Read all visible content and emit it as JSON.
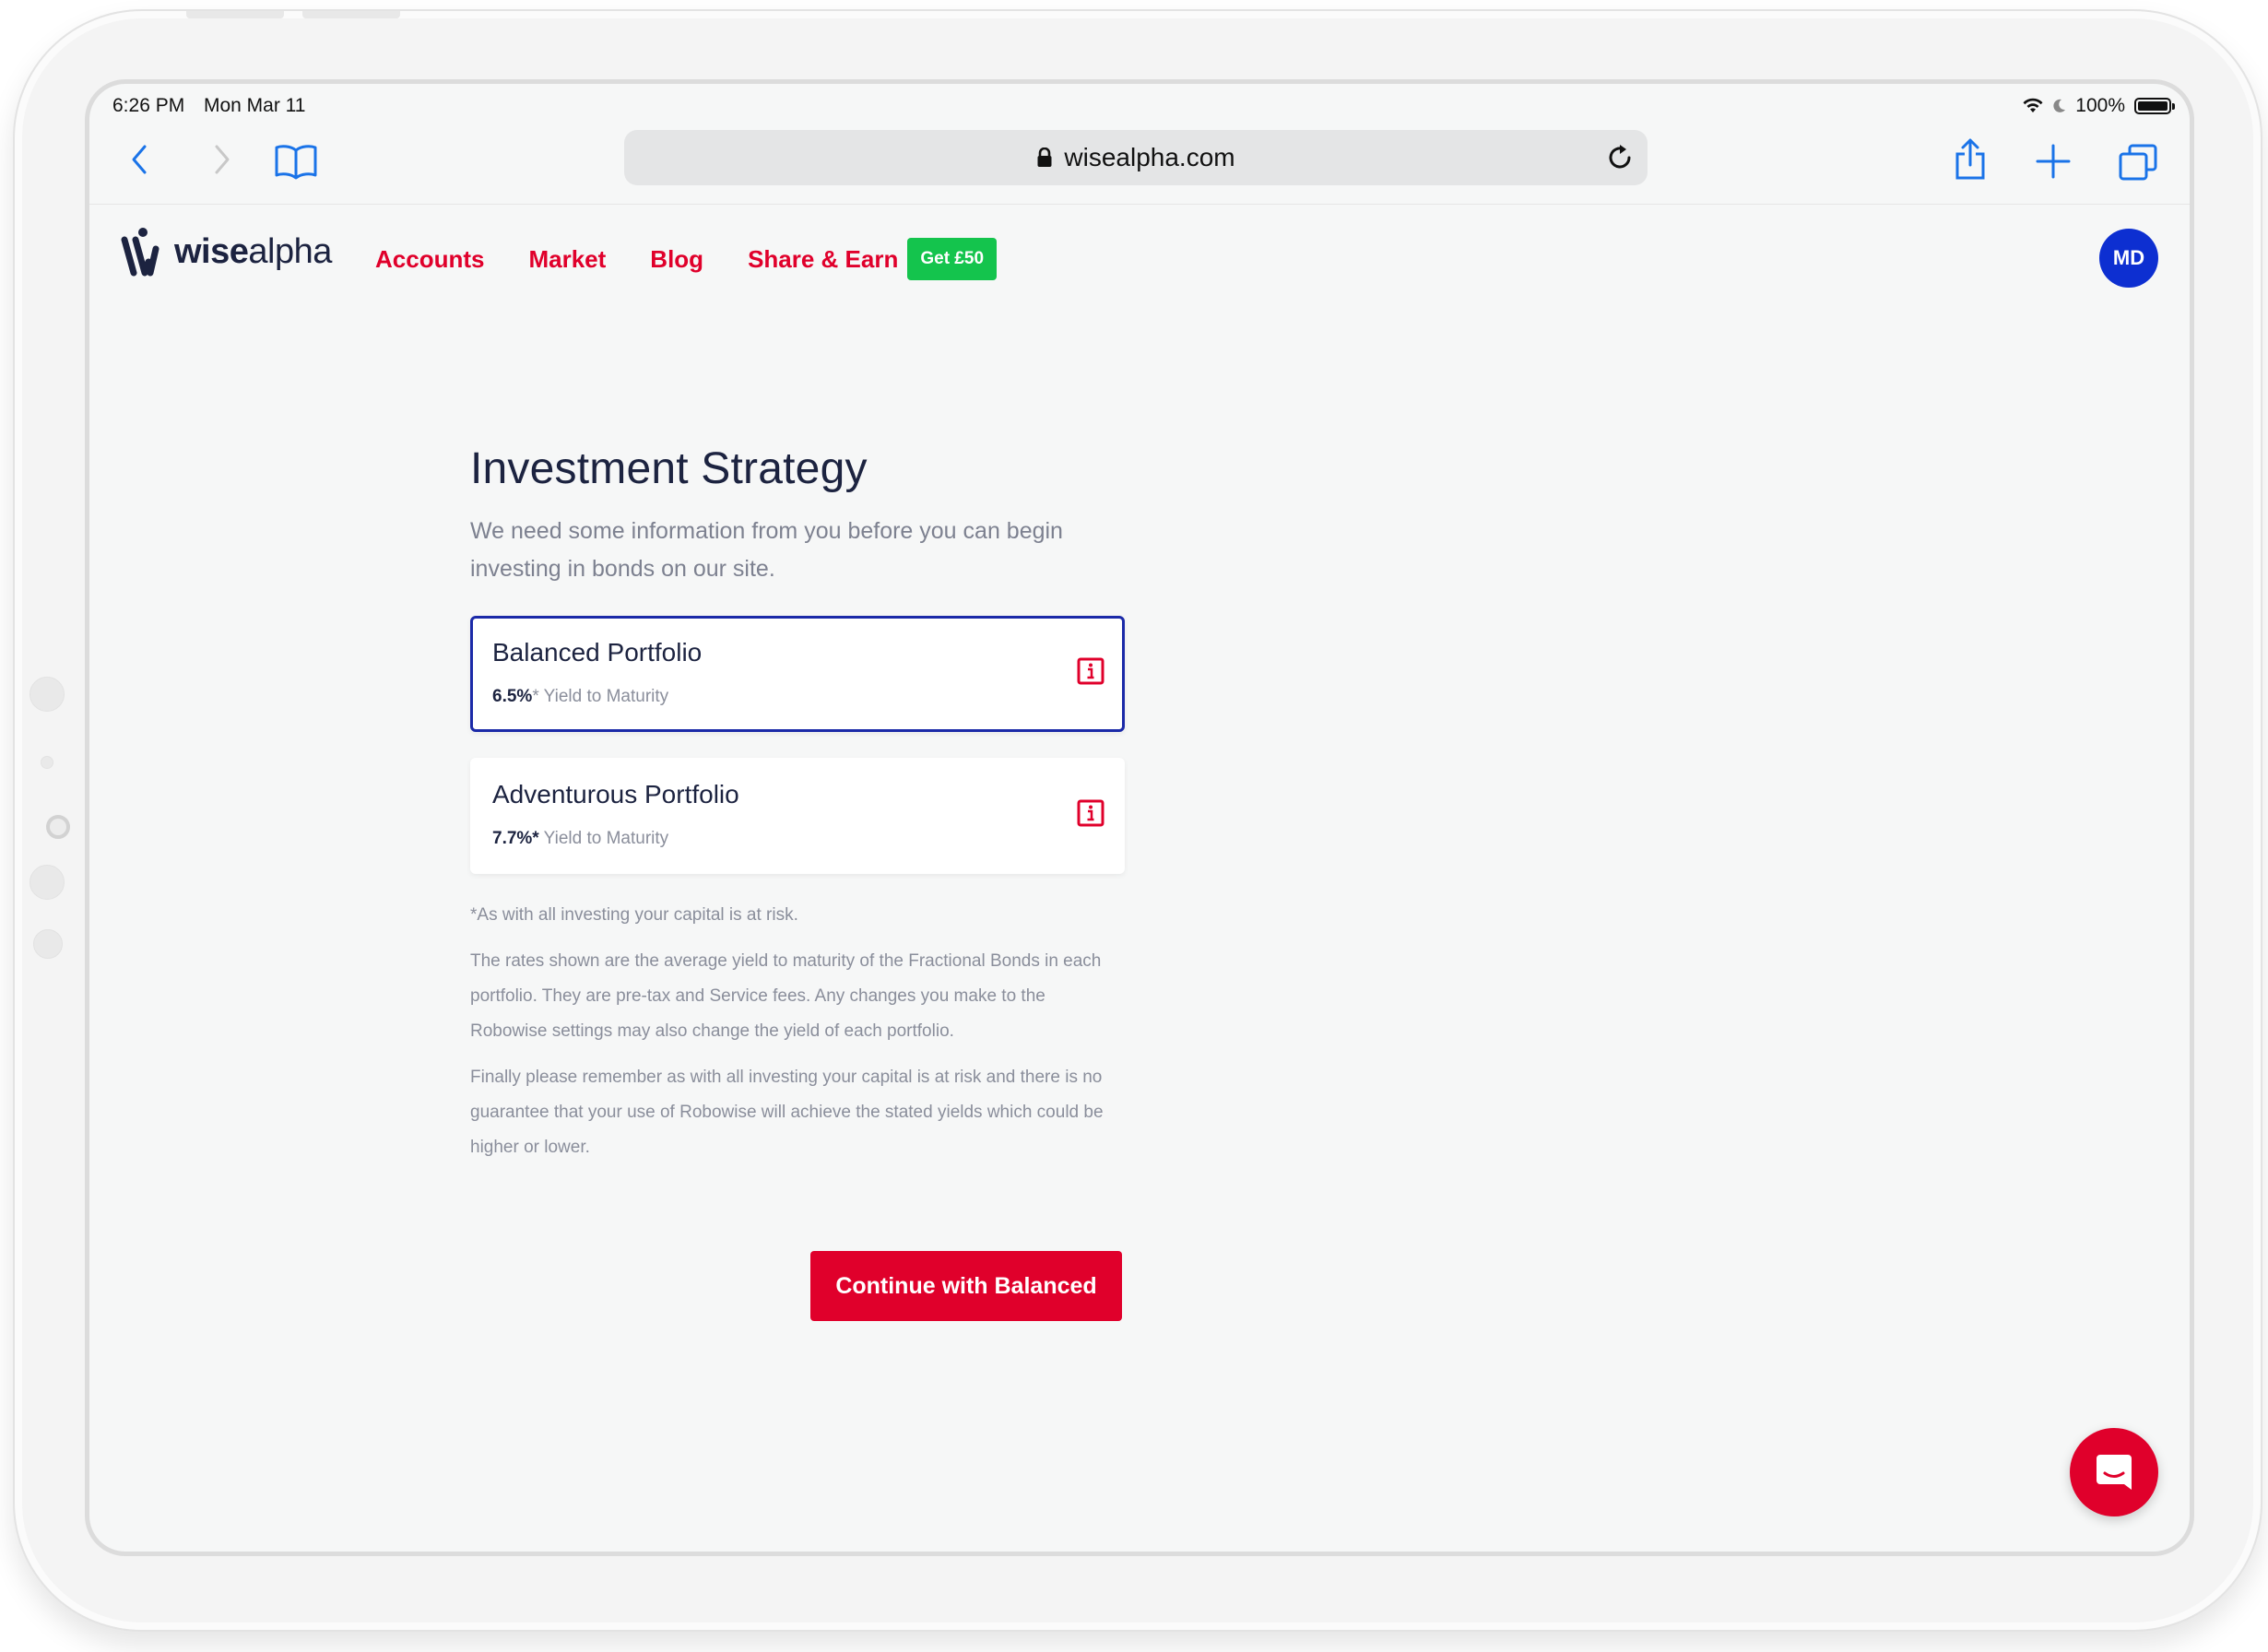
{
  "status_bar": {
    "time": "6:26 PM",
    "date": "Mon Mar 11",
    "battery": "100%"
  },
  "browser": {
    "url": "wisealpha.com",
    "icons": {
      "back": "chevron-left-icon",
      "forward": "chevron-right-icon",
      "bookmarks": "book-icon",
      "lock": "lock-icon",
      "reload": "reload-icon",
      "share": "share-icon",
      "new_tab": "plus-icon",
      "tabs": "tabs-icon"
    }
  },
  "site": {
    "logo": {
      "bold": "wise",
      "light": "alpha"
    },
    "nav": [
      {
        "label": "Accounts"
      },
      {
        "label": "Market"
      },
      {
        "label": "Blog"
      },
      {
        "label": "Share & Earn"
      }
    ],
    "promo_badge": "Get £50",
    "avatar_initials": "MD"
  },
  "page": {
    "title": "Investment Strategy",
    "subtitle": "We need some information from you before you can begin investing in bonds on our site.",
    "portfolios": [
      {
        "name": "Balanced Portfolio",
        "yield": "6.5%",
        "yield_suffix": "* Yield to Maturity",
        "selected": true
      },
      {
        "name": "Adventurous Portfolio",
        "yield": "7.7%*",
        "yield_suffix": " Yield to Maturity",
        "selected": false
      }
    ],
    "notes": [
      "*As with all investing your capital is at risk.",
      "The rates shown are the average yield to maturity of the Fractional Bonds in each portfolio. They are pre-tax and Service fees. Any changes you make to the Robowise settings may also change the yield of each portfolio.",
      "Finally please remember as with all investing your capital is at risk and there is no guarantee that your use of Robowise will achieve the stated yields which could be higher or lower."
    ],
    "cta_label": "Continue with Balanced"
  },
  "colors": {
    "brand_red": "#e0002b",
    "brand_navy": "#1c2340",
    "selected_border": "#1b2aa8",
    "promo_green": "#14c44d",
    "avatar_blue": "#0d2fd1"
  }
}
